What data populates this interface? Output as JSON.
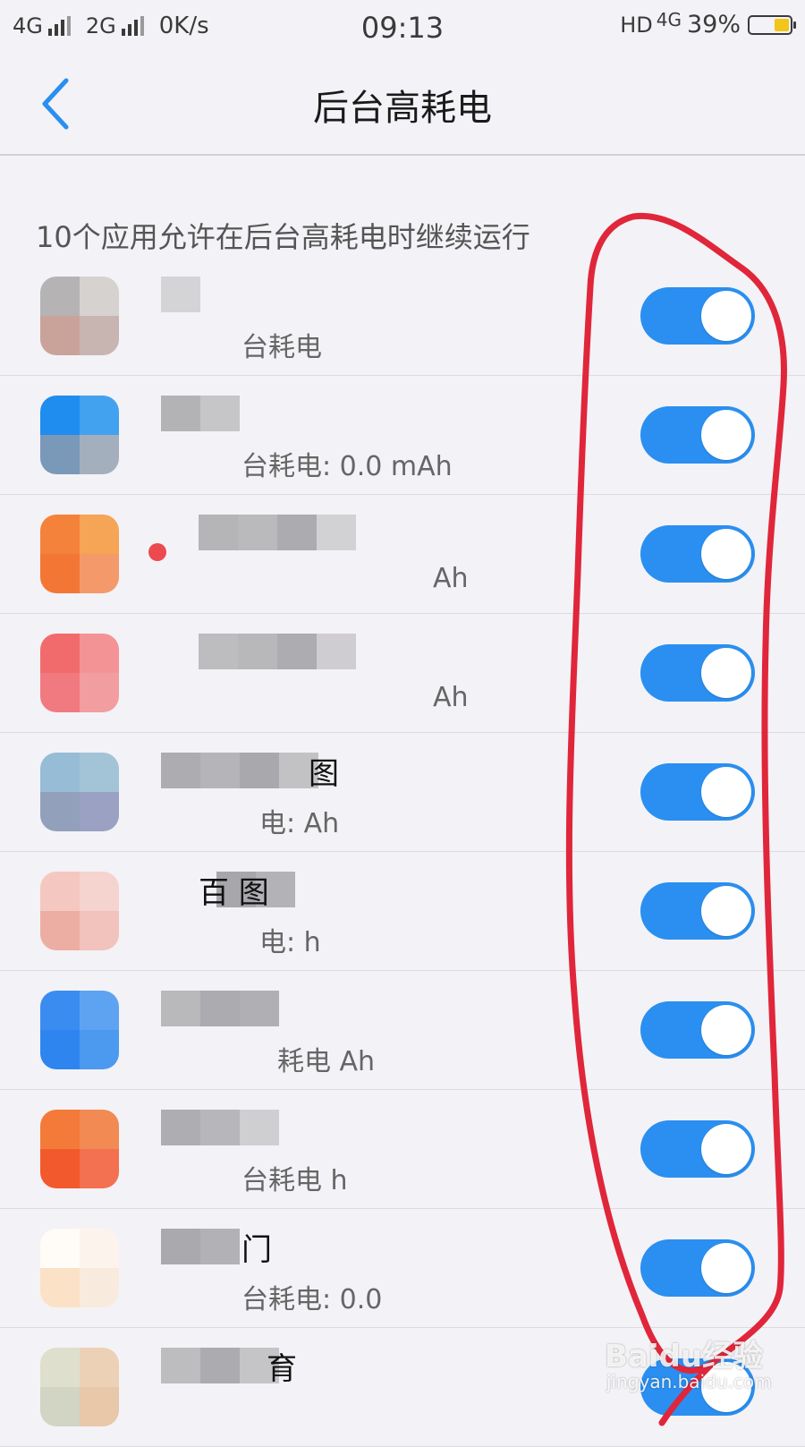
{
  "status_bar": {
    "net1_label": "4G",
    "net2_label": "2G",
    "speed": "0K/s",
    "time": "09:13",
    "hd": "HD",
    "lte": "4G",
    "battery_pct": "39%",
    "battery_level": 0.39
  },
  "nav": {
    "back_icon": "chevron-left-icon",
    "title": "后台高耗电"
  },
  "section_header": "10个应用允许在后台高耗电时继续运行",
  "apps": [
    {
      "name": "",
      "usage": "台耗电",
      "toggle_on": true
    },
    {
      "name": "",
      "usage": "台耗电: 0.0 mAh",
      "toggle_on": true
    },
    {
      "name": "",
      "usage": "Ah",
      "toggle_on": true
    },
    {
      "name": "",
      "usage": "Ah",
      "toggle_on": true
    },
    {
      "name": "图",
      "usage": "电: Ah",
      "toggle_on": true
    },
    {
      "name": "百 图",
      "usage": "电: h",
      "toggle_on": true
    },
    {
      "name": "",
      "usage": "耗电 Ah",
      "toggle_on": true
    },
    {
      "name": "",
      "usage": "台耗电 h",
      "toggle_on": true
    },
    {
      "name": "门",
      "usage": "台耗电: 0.0",
      "toggle_on": true
    },
    {
      "name": "育",
      "usage": "",
      "toggle_on": true
    }
  ],
  "colors": {
    "accent": "#2a8ff0",
    "annotation": "#e0263a",
    "background": "#f3f2f6"
  },
  "watermark": {
    "brand": "Baidu经验",
    "site": "jingyan.baidu.com"
  }
}
